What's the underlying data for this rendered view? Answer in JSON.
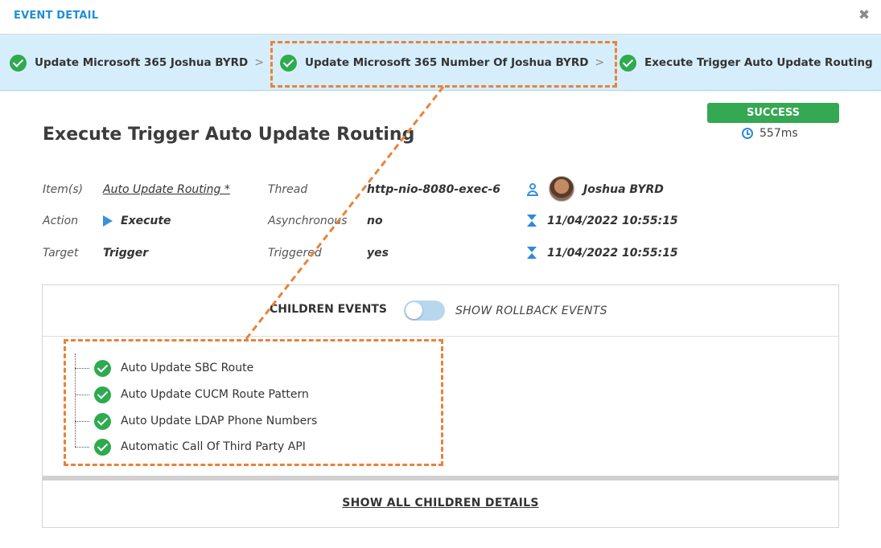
{
  "header": {
    "title": "EVENT DETAIL",
    "close_glyph": "✖"
  },
  "breadcrumb": {
    "items": [
      {
        "label": "Update Microsoft 365 Joshua BYRD",
        "separator": ">"
      },
      {
        "label": "Update Microsoft 365 Number Of Joshua BYRD",
        "separator": ">"
      },
      {
        "label": "Execute Trigger Auto Update Routing",
        "separator": ""
      }
    ]
  },
  "status": {
    "label": "SUCCESS",
    "duration": "557ms",
    "color": "#34a853"
  },
  "page_title": "Execute Trigger Auto Update Routing",
  "details": {
    "items_label": "Item(s)",
    "items_value": "Auto Update Routing *",
    "action_label": "Action",
    "action_value": "Execute",
    "target_label": "Target",
    "target_value": "Trigger",
    "thread_label": "Thread",
    "thread_value": "http-nio-8080-exec-6",
    "async_label": "Asynchronous",
    "async_value": "no",
    "triggered_label": "Triggered",
    "triggered_value": "yes",
    "user_name": "Joshua BYRD",
    "start_time": "11/04/2022 10:55:15",
    "end_time": "11/04/2022 10:55:15"
  },
  "children": {
    "title": "CHILDREN EVENTS",
    "rollback_label": "SHOW ROLLBACK EVENTS",
    "rollback_toggle_on": false,
    "items": [
      {
        "label": "Auto Update SBC Route"
      },
      {
        "label": "Auto Update CUCM Route Pattern"
      },
      {
        "label": "Auto Update LDAP Phone Numbers"
      },
      {
        "label": "Automatic Call Of Third Party API"
      }
    ],
    "show_all_label": "SHOW ALL CHILDREN DETAILS"
  },
  "colors": {
    "accent": "#1e8fd6",
    "success": "#2eaa4f",
    "annotation": "#e8833a"
  }
}
